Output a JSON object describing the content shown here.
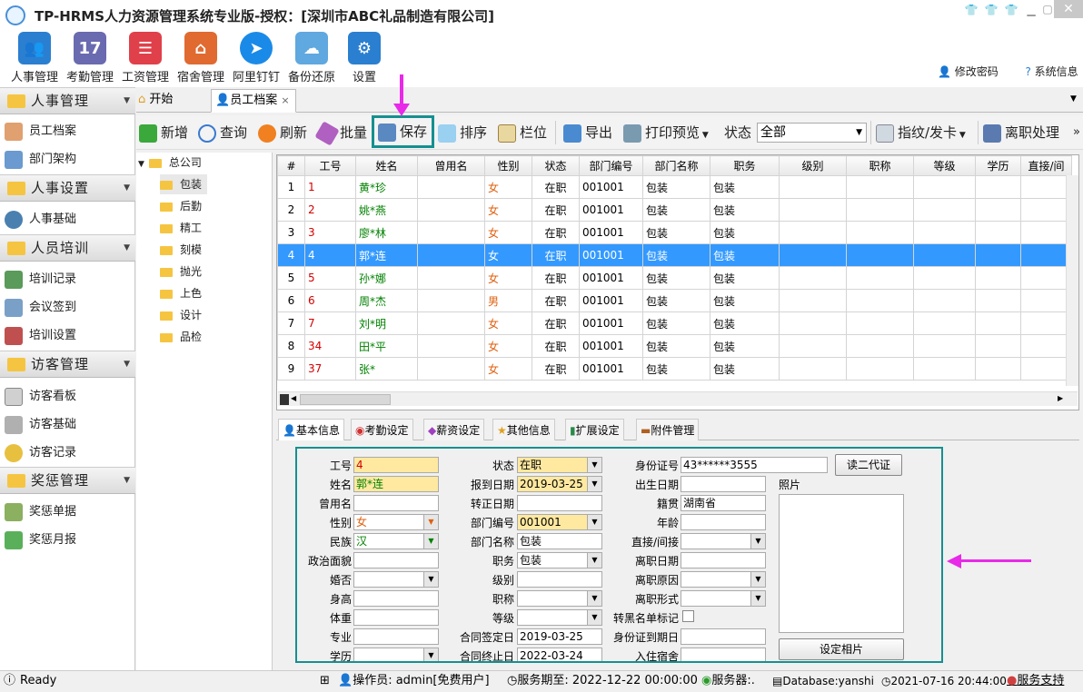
{
  "window": {
    "title": "TP-HRMS人力资源管理系统专业版-授权：[深圳市ABC礼品制造有限公司]"
  },
  "mainmenu": [
    {
      "label": "人事管理",
      "icon": "people-icon",
      "color": "#2a7fd0"
    },
    {
      "label": "考勤管理",
      "icon": "calendar-icon",
      "color": "#6a6ab0"
    },
    {
      "label": "工资管理",
      "icon": "payroll-icon",
      "color": "#e0404a"
    },
    {
      "label": "宿舍管理",
      "icon": "house-icon",
      "color": "#e06a30"
    },
    {
      "label": "阿里钉钉",
      "icon": "dingtalk-icon",
      "color": "#1a8ae8"
    },
    {
      "label": "备份还原",
      "icon": "cloud-icon",
      "color": "#60a8e0"
    },
    {
      "label": "设置",
      "icon": "gear-icon",
      "color": "#2a7fd0"
    }
  ],
  "top_links": {
    "change_password": "修改密码",
    "system_info": "系统信息"
  },
  "sidebar": {
    "sections": [
      {
        "title": "人事管理",
        "items": [
          "员工档案",
          "部门架构"
        ]
      },
      {
        "title": "人事设置",
        "items": [
          "人事基础"
        ]
      },
      {
        "title": "人员培训",
        "items": [
          "培训记录",
          "会议签到",
          "培训设置"
        ]
      },
      {
        "title": "访客管理",
        "items": [
          "访客看板",
          "访客基础",
          "访客记录"
        ]
      },
      {
        "title": "奖惩管理",
        "items": [
          "奖惩单据",
          "奖惩月报"
        ]
      }
    ]
  },
  "tabs": [
    {
      "label": "开始"
    },
    {
      "label": "员工档案"
    }
  ],
  "tab_close": "×",
  "toolbar": {
    "add": "新增",
    "query": "查询",
    "refresh": "刷新",
    "batch": "批量",
    "save": "保存",
    "sort": "排序",
    "columns": "栏位",
    "export": "导出",
    "print_preview": "打印预览",
    "status_label": "状态",
    "status_value": "全部",
    "fingerprint": "指纹/发卡",
    "resign": "离职处理",
    "more": "»"
  },
  "tree": {
    "root": "总公司",
    "children": [
      "包装",
      "后勤",
      "精工",
      "刻模",
      "抛光",
      "上色",
      "设计",
      "品检"
    ],
    "selected": "包装"
  },
  "grid": {
    "columns": [
      "#",
      "工号",
      "姓名",
      "曾用名",
      "性别",
      "状态",
      "部门编号",
      "部门名称",
      "职务",
      "级别",
      "职称",
      "等级",
      "学历",
      "直接/间"
    ],
    "rows": [
      {
        "n": "1",
        "id": "1",
        "name": "黄*珍",
        "alias": "",
        "sex": "女",
        "status": "在职",
        "dept_no": "001001",
        "dept": "包装",
        "pos": "包装"
      },
      {
        "n": "2",
        "id": "2",
        "name": "姚*燕",
        "alias": "",
        "sex": "女",
        "status": "在职",
        "dept_no": "001001",
        "dept": "包装",
        "pos": "包装"
      },
      {
        "n": "3",
        "id": "3",
        "name": "廖*林",
        "alias": "",
        "sex": "女",
        "status": "在职",
        "dept_no": "001001",
        "dept": "包装",
        "pos": "包装"
      },
      {
        "n": "4",
        "id": "4",
        "name": "郭*连",
        "alias": "",
        "sex": "女",
        "status": "在职",
        "dept_no": "001001",
        "dept": "包装",
        "pos": "包装"
      },
      {
        "n": "5",
        "id": "5",
        "name": "孙*娜",
        "alias": "",
        "sex": "女",
        "status": "在职",
        "dept_no": "001001",
        "dept": "包装",
        "pos": "包装"
      },
      {
        "n": "6",
        "id": "6",
        "name": "周*杰",
        "alias": "",
        "sex": "男",
        "status": "在职",
        "dept_no": "001001",
        "dept": "包装",
        "pos": "包装"
      },
      {
        "n": "7",
        "id": "7",
        "name": "刘*明",
        "alias": "",
        "sex": "女",
        "status": "在职",
        "dept_no": "001001",
        "dept": "包装",
        "pos": "包装"
      },
      {
        "n": "8",
        "id": "34",
        "name": "田*平",
        "alias": "",
        "sex": "女",
        "status": "在职",
        "dept_no": "001001",
        "dept": "包装",
        "pos": "包装"
      },
      {
        "n": "9",
        "id": "37",
        "name": "张*",
        "alias": "",
        "sex": "女",
        "status": "在职",
        "dept_no": "001001",
        "dept": "包装",
        "pos": "包装"
      }
    ],
    "selected_row": "4"
  },
  "detail_tabs": [
    "基本信息",
    "考勤设定",
    "薪资设定",
    "其他信息",
    "扩展设定",
    "附件管理"
  ],
  "form": {
    "emp_id": {
      "label": "工号",
      "value": "4"
    },
    "name": {
      "label": "姓名",
      "value": "郭*连"
    },
    "alias": {
      "label": "曾用名",
      "value": ""
    },
    "sex": {
      "label": "性别",
      "value": "女"
    },
    "ethnicity": {
      "label": "民族",
      "value": "汉"
    },
    "political": {
      "label": "政治面貌",
      "value": ""
    },
    "marital": {
      "label": "婚否",
      "value": ""
    },
    "height": {
      "label": "身高",
      "value": ""
    },
    "weight": {
      "label": "体重",
      "value": ""
    },
    "major": {
      "label": "专业",
      "value": ""
    },
    "education": {
      "label": "学历",
      "value": ""
    },
    "status": {
      "label": "状态",
      "value": "在职"
    },
    "join_date": {
      "label": "报到日期",
      "value": "2019-03-25"
    },
    "regular_date": {
      "label": "转正日期",
      "value": ""
    },
    "dept_no": {
      "label": "部门编号",
      "value": "001001"
    },
    "dept_name": {
      "label": "部门名称",
      "value": "包装"
    },
    "position": {
      "label": "职务",
      "value": "包装"
    },
    "level": {
      "label": "级别",
      "value": ""
    },
    "title": {
      "label": "职称",
      "value": ""
    },
    "grade": {
      "label": "等级",
      "value": ""
    },
    "contract_date": {
      "label": "合同签定日",
      "value": "2019-03-25"
    },
    "contract_end": {
      "label": "合同终止日",
      "value": "2022-03-24"
    },
    "id_card": {
      "label": "身份证号",
      "value": "43******3555"
    },
    "birth_date": {
      "label": "出生日期",
      "value": ""
    },
    "hometown": {
      "label": "籍贯",
      "value": "湖南省"
    },
    "age": {
      "label": "年龄",
      "value": ""
    },
    "direct": {
      "label": "直接/间接",
      "value": ""
    },
    "leave_date": {
      "label": "离职日期",
      "value": ""
    },
    "leave_reason": {
      "label": "离职原因",
      "value": ""
    },
    "leave_form": {
      "label": "离职形式",
      "value": ""
    },
    "blacklist": {
      "label": "转黑名单标记"
    },
    "id_expire": {
      "label": "身份证到期日",
      "value": ""
    },
    "join_security": {
      "label": "入住宿舍",
      "value": ""
    },
    "read_id": "读二代证",
    "photo": "照片",
    "set_photo": "设定相片"
  },
  "statusbar": {
    "ready": "Ready",
    "operator": "操作员: admin[免费用户]",
    "service_expiry": "服务期至: 2022-12-22 00:00:00",
    "server": "服务器:.",
    "database": "Database:yanshi",
    "datetime": "2021-07-16 20:44:00",
    "support": "服务支持"
  },
  "colors": {
    "selected_row": "#3399ff",
    "highlight_border": "#159090",
    "arrow": "#e829e8",
    "required_field": "#ffe9a0"
  }
}
